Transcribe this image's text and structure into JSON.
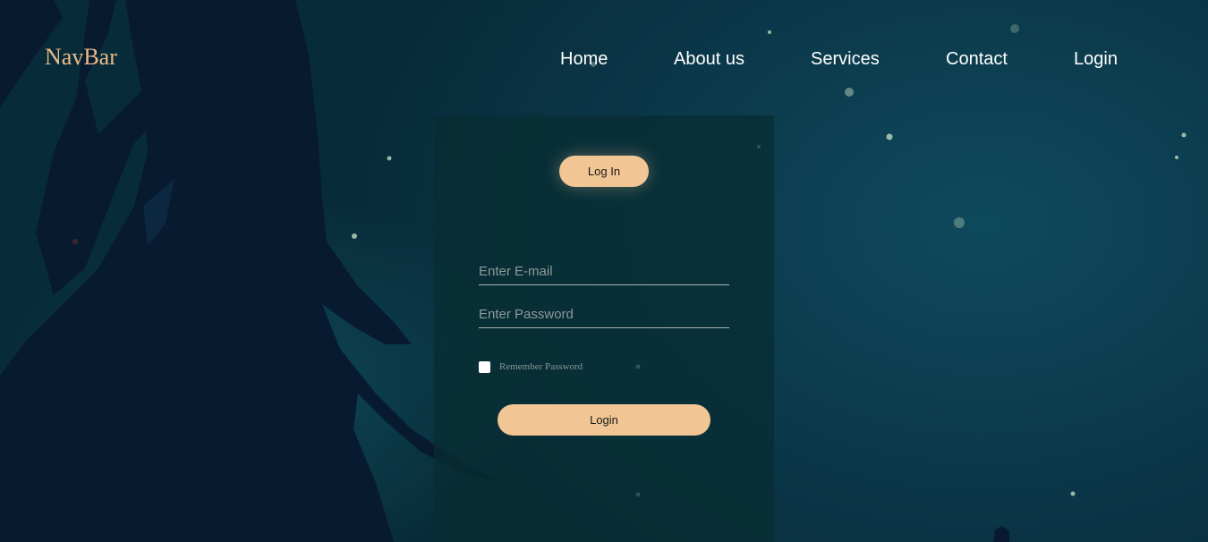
{
  "navbar": {
    "brand": "NavBar",
    "links": [
      "Home",
      "About us",
      "Services",
      "Contact",
      "Login"
    ]
  },
  "login_form": {
    "tab_label": "Log In",
    "email_placeholder": "Enter E-mail",
    "password_placeholder": "Enter Password",
    "remember_label": "Remember Password",
    "submit_label": "Login"
  },
  "colors": {
    "accent": "#f2c594",
    "brand_text": "#e8bb88",
    "background": "#0b3a4c"
  }
}
